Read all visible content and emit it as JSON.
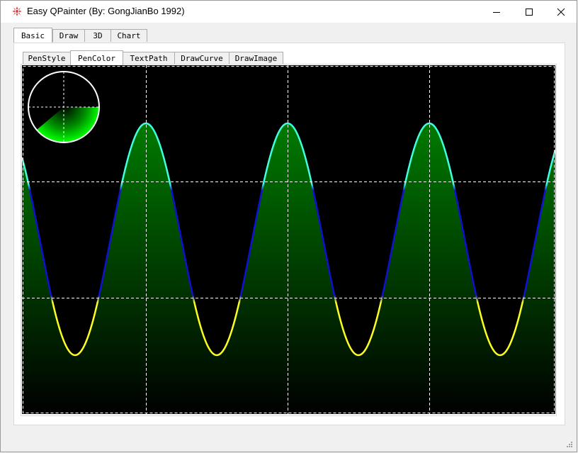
{
  "window": {
    "title": "Easy QPainter (By: GongJianBo 1992)"
  },
  "outer_tabs": [
    {
      "label": "Basic",
      "active": true
    },
    {
      "label": "Draw",
      "active": false
    },
    {
      "label": "3D",
      "active": false
    },
    {
      "label": "Chart",
      "active": false
    }
  ],
  "inner_tabs": [
    {
      "label": "PenStyle",
      "active": false
    },
    {
      "label": "PenColor",
      "active": true
    },
    {
      "label": "TextPath",
      "active": false
    },
    {
      "label": "DrawCurve",
      "active": false
    },
    {
      "label": "DrawImage",
      "active": false
    }
  ],
  "canvas": {
    "background": "#000000",
    "grid_color": "#ffffff",
    "fill_gradient": [
      "#007a00",
      "#000000"
    ],
    "pen_colors": {
      "peak": "#40ffe0",
      "mid": "#1010d0",
      "trough": "#ffff20"
    },
    "cycles": 3.75,
    "icons": {
      "pie_indicator": "pie-gauge-icon"
    }
  },
  "colors": {
    "app_icon": "#e0474c"
  }
}
